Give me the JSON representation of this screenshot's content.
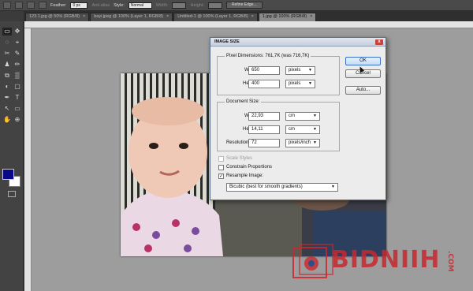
{
  "options_bar": {
    "feather_label": "Feather:",
    "feather_value": "0 px",
    "antialias_label": "Anti-alias",
    "style_label": "Style:",
    "style_value": "Normal",
    "width_label": "Width:",
    "height_label": "Height:",
    "refine_label": "Refine Edge..."
  },
  "tabs": [
    {
      "label": "123.1.jpg @ 50% (RGB/8)",
      "active": false
    },
    {
      "label": "bayi.jpeg @ 100% (Layer 1, RGB/8)",
      "active": false
    },
    {
      "label": "Untitled-1 @ 100% (Layer 1, RGB/8)",
      "active": false
    },
    {
      "label": "1.jpg @ 100% (RGB/8)",
      "active": true
    }
  ],
  "tab_close_glyph": "×",
  "tools": [
    "▭",
    "✥",
    "◌",
    "⌖",
    "✂",
    "✎",
    "♟",
    "✏",
    "⧉",
    "▒",
    "◐",
    "▢",
    "✒",
    "T",
    "↖",
    "▭",
    "✋",
    "⊕"
  ],
  "dialog": {
    "title": "IMAGE SIZE",
    "close_glyph": "x",
    "pixel_dimensions_label": "Pixel Dimensions: 761,7K (was 716,7K)",
    "pixel_width_label": "Width:",
    "pixel_width": "650",
    "pixel_width_unit": "pixels",
    "pixel_height_label": "Height:",
    "pixel_height": "400",
    "pixel_height_unit": "pixels",
    "document_size_label": "Document Size:",
    "doc_width_label": "Width:",
    "doc_width": "22,93",
    "doc_width_unit": "cm",
    "doc_height_label": "Height:",
    "doc_height": "14,11",
    "doc_height_unit": "cm",
    "resolution_label": "Resolution:",
    "resolution": "72",
    "resolution_unit": "pixels/inch",
    "scale_styles_label": "Scale Styles",
    "scale_styles_checked": false,
    "constrain_label": "Constrain Proportions",
    "constrain_checked": false,
    "resample_label": "Resample Image:",
    "resample_checked": true,
    "resample_method": "Bicubic (best for smooth gradients)",
    "ok_label": "OK",
    "cancel_label": "Cancel",
    "auto_label": "Auto...",
    "check_glyph": "✓",
    "dropdown_glyph": "▼"
  },
  "watermark": {
    "text": "BIDNIIH",
    "suffix": ".COM",
    "color": "#c8282e"
  },
  "colors": {
    "foreground": "#080888",
    "background": "#ffffff",
    "canvas": "#9d9d9d"
  }
}
